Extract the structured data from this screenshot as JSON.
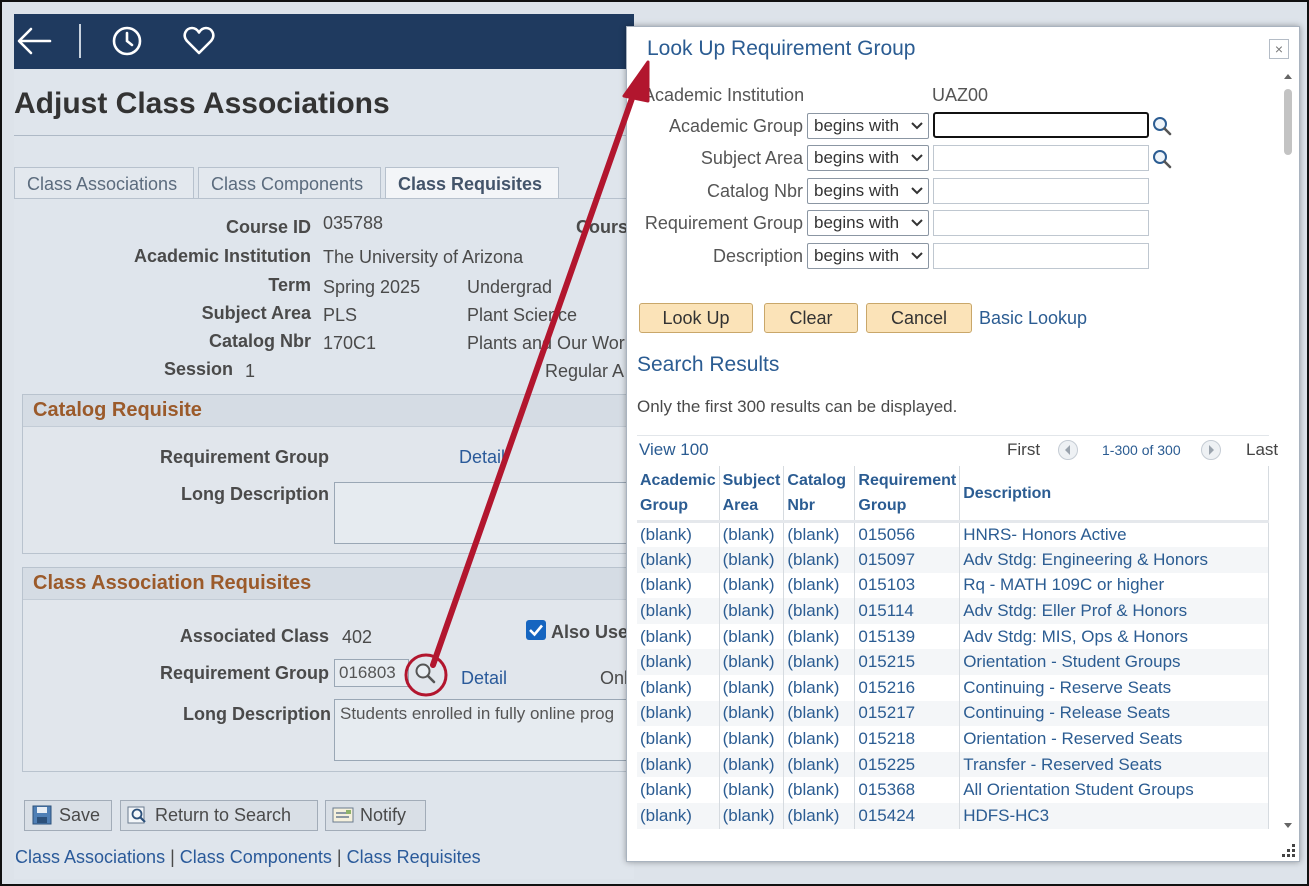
{
  "page": {
    "title": "Adjust Class Associations",
    "tabs": [
      {
        "label": "Class Associations"
      },
      {
        "label": "Class Components"
      },
      {
        "label": "Class Requisites"
      }
    ],
    "header_fields": {
      "course_id_label": "Course ID",
      "course_id": "035788",
      "course_cut_label": "Cours",
      "institution_label": "Academic Institution",
      "institution": "The University of Arizona",
      "term_label": "Term",
      "term": "Spring 2025",
      "career": "Undergrad",
      "subject_label": "Subject Area",
      "subject": "PLS",
      "subject_desc": "Plant Science",
      "catalog_label": "Catalog Nbr",
      "catalog": "170C1",
      "catalog_desc": "Plants and Our Worl",
      "session_label": "Session",
      "session": "1",
      "session_desc": "Regular A"
    },
    "catalog_requisite": {
      "heading": "Catalog Requisite",
      "req_group_label": "Requirement Group",
      "detail_link": "Detail",
      "long_desc_label": "Long Description",
      "long_desc": ""
    },
    "class_assoc_requisites": {
      "heading": "Class Association Requisites",
      "assoc_class_label": "Associated Class",
      "assoc_class": "402",
      "also_use_label": "Also Use",
      "also_use_checked": true,
      "req_group_label": "Requirement Group",
      "req_group": "016803",
      "detail_link": "Detail",
      "onl_cut": "Onl",
      "long_desc_label": "Long Description",
      "long_desc": "Students enrolled in fully online prog"
    },
    "buttons": {
      "save": "Save",
      "return_to_search": "Return to Search",
      "notify": "Notify"
    },
    "bottom_links": [
      "Class Associations",
      "Class Components",
      "Class Requisites"
    ],
    "bottom_sep": "|"
  },
  "modal": {
    "title": "Look Up Requirement Group",
    "close_glyph": "×",
    "institution_label": "Academic Institution",
    "institution_value": "UAZ00",
    "criteria": [
      {
        "label": "Academic Group",
        "operator": "begins with",
        "value": "",
        "has_lookup": true
      },
      {
        "label": "Subject Area",
        "operator": "begins with",
        "value": "",
        "has_lookup": true
      },
      {
        "label": "Catalog Nbr",
        "operator": "begins with",
        "value": "",
        "has_lookup": false
      },
      {
        "label": "Requirement Group",
        "operator": "begins with",
        "value": "",
        "has_lookup": false
      },
      {
        "label": "Description",
        "operator": "begins with",
        "value": "",
        "has_lookup": false
      }
    ],
    "buttons": {
      "lookup": "Look Up",
      "clear": "Clear",
      "cancel": "Cancel"
    },
    "basic_lookup": "Basic Lookup",
    "results_heading": "Search Results",
    "results_note": "Only the first 300 results can be displayed.",
    "view_100": "View 100",
    "nav_first": "First",
    "nav_count": "1-300 of 300",
    "nav_last": "Last",
    "columns": [
      [
        "Academic",
        "Group"
      ],
      [
        "Subject",
        "Area"
      ],
      [
        "Catalog",
        "Nbr"
      ],
      [
        "Requirement",
        "Group"
      ],
      [
        "Description"
      ]
    ],
    "rows": [
      [
        "(blank)",
        "(blank)",
        "(blank)",
        "015056",
        "HNRS- Honors Active"
      ],
      [
        "(blank)",
        "(blank)",
        "(blank)",
        "015097",
        "Adv Stdg: Engineering & Honors"
      ],
      [
        "(blank)",
        "(blank)",
        "(blank)",
        "015103",
        "Rq - MATH 109C or higher"
      ],
      [
        "(blank)",
        "(blank)",
        "(blank)",
        "015114",
        "Adv Stdg: Eller Prof & Honors"
      ],
      [
        "(blank)",
        "(blank)",
        "(blank)",
        "015139",
        "Adv Stdg: MIS, Ops & Honors"
      ],
      [
        "(blank)",
        "(blank)",
        "(blank)",
        "015215",
        "Orientation - Student Groups"
      ],
      [
        "(blank)",
        "(blank)",
        "(blank)",
        "015216",
        "Continuing - Reserve Seats"
      ],
      [
        "(blank)",
        "(blank)",
        "(blank)",
        "015217",
        "Continuing - Release Seats"
      ],
      [
        "(blank)",
        "(blank)",
        "(blank)",
        "015218",
        "Orientation - Reserved Seats"
      ],
      [
        "(blank)",
        "(blank)",
        "(blank)",
        "015225",
        "Transfer - Reserved Seats"
      ],
      [
        "(blank)",
        "(blank)",
        "(blank)",
        "015368",
        "All Orientation Student Groups"
      ],
      [
        "(blank)",
        "(blank)",
        "(blank)",
        "015424",
        "HDFS-HC3"
      ]
    ]
  },
  "icons": {
    "back": "back-arrow-icon",
    "history": "clock-icon",
    "favorites": "heart-icon",
    "lookup": "magnifier-icon"
  },
  "colors": {
    "header_bar": "#1f3a5f",
    "link": "#2b5c92",
    "section_heading": "#9b5a2a",
    "button_orange": "#fbe3b8",
    "annotation_red": "#b2162e"
  }
}
